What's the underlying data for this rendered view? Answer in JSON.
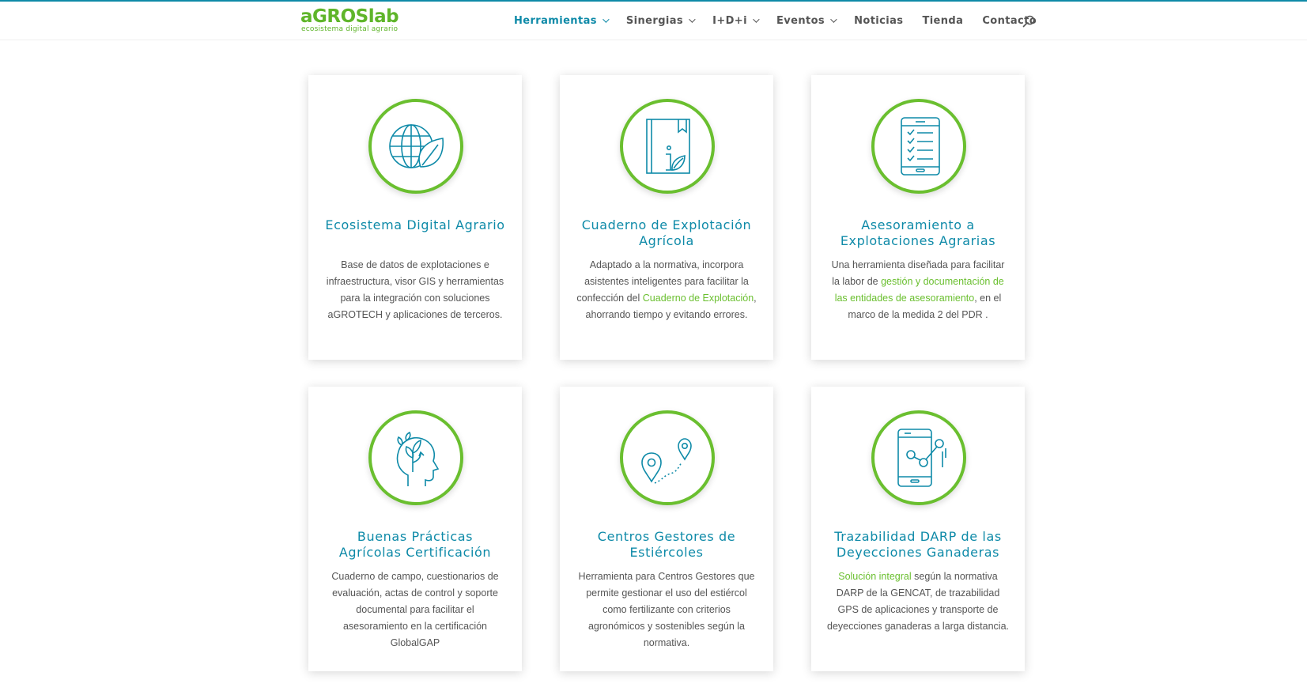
{
  "colors": {
    "brand_blue": "#0e8aa8",
    "brand_green": "#6abf2f",
    "text_gray": "#555555"
  },
  "logo": {
    "name": "aGROSlab",
    "tagline": "ecosistema digital agrario"
  },
  "nav": {
    "items": [
      {
        "label": "Herramientas",
        "dropdown": true,
        "active": true
      },
      {
        "label": "Sinergias",
        "dropdown": true
      },
      {
        "label": "I+D+i",
        "dropdown": true
      },
      {
        "label": "Eventos",
        "dropdown": true
      },
      {
        "label": "Noticias"
      },
      {
        "label": "Tienda"
      },
      {
        "label": "Contacto"
      }
    ],
    "search_icon": "search-icon"
  },
  "cards": [
    {
      "icon": "globe-leaf-icon",
      "title": "Ecosistema Digital Agrario",
      "text": [
        {
          "t": "Base de datos de explotaciones e infraestructura, visor GIS y herramientas para la integración con soluciones aGROTECH y aplicaciones de terceros."
        }
      ]
    },
    {
      "icon": "notebook-leaf-icon",
      "title": "Cuaderno de Explotación Agrícola",
      "text": [
        {
          "t": "Adaptado a la normativa, incorpora asistentes inteligentes para facilitar la confección del "
        },
        {
          "t": "Cuaderno de Explotación",
          "link": true
        },
        {
          "t": ", ahorrando tiempo y evitando errores."
        }
      ]
    },
    {
      "icon": "tablet-checklist-icon",
      "title": "Asesoramiento a Explotaciones Agrarias",
      "text": [
        {
          "t": "Una herramienta diseñada para facilitar la labor de "
        },
        {
          "t": "gestión y documentación de las entidades de asesoramiento",
          "link": true
        },
        {
          "t": ", en el marco de la medida 2 del PDR ."
        }
      ]
    },
    {
      "icon": "head-plant-icon",
      "title": "Buenas Prácticas Agrícolas Certificación",
      "text": [
        {
          "t": "Cuaderno de campo, cuestionarios de evaluación, actas de control y soporte documental para facilitar el asesoramiento en la certificación GlobalGAP"
        }
      ]
    },
    {
      "icon": "route-pins-icon",
      "title": "Centros Gestores de Estiércoles",
      "text": [
        {
          "t": "Herramienta para Centros Gestores que permite gestionar el uso del estiércol como fertilizante con criterios agronómicos y sostenibles según la normativa."
        }
      ]
    },
    {
      "icon": "phone-tracking-icon",
      "title": "Trazabilidad DARP de las Deyecciones Ganaderas",
      "text": [
        {
          "t": "Solución integral",
          "link": true
        },
        {
          "t": " según la normativa DARP de la GENCAT, de trazabilidad GPS de aplicaciones y transporte de deyecciones ganaderas a larga distancia."
        }
      ]
    }
  ]
}
